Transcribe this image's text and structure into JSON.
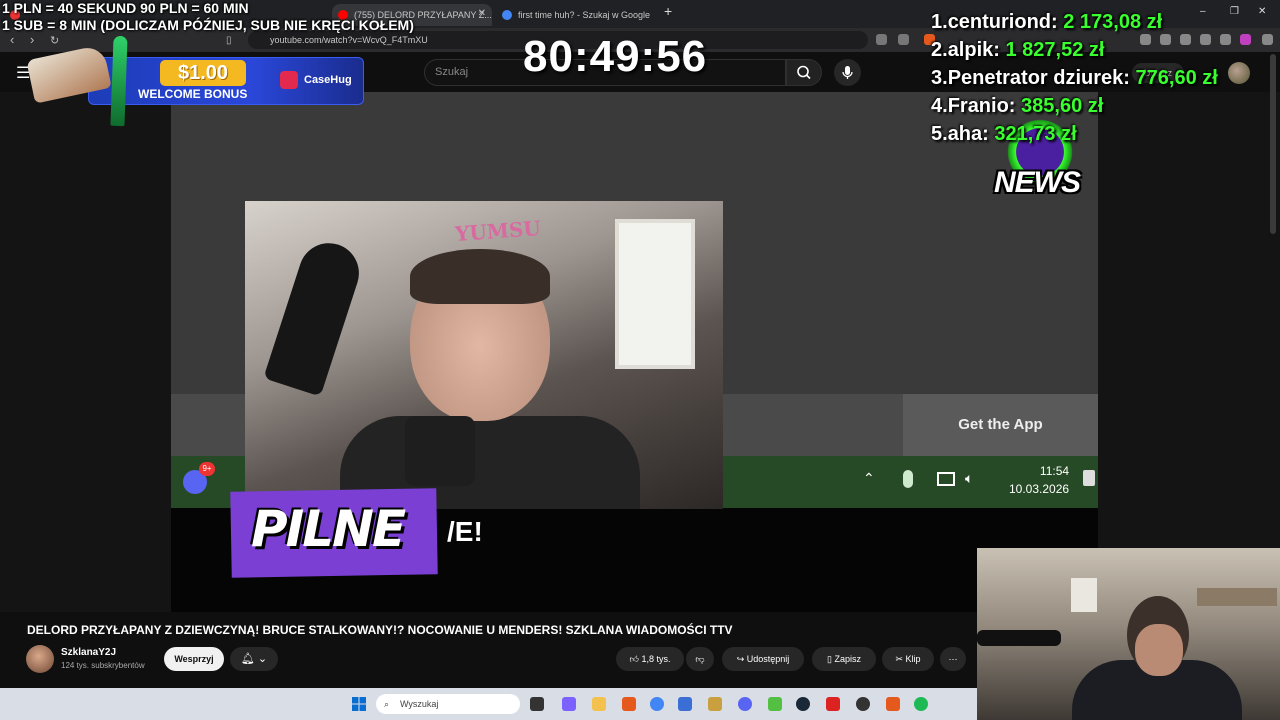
{
  "browser": {
    "tabs": [
      {
        "label": "(755) DELORD PRZYŁAPANY Z...",
        "active": true
      },
      {
        "label": "first time huh? - Szukaj w Google",
        "active": false
      }
    ],
    "url": "youtube.com/watch?v=WcvQ_F4TmXU"
  },
  "youtube": {
    "search_placeholder": "Szukaj",
    "create_label": "Utwórz",
    "video": {
      "getapp_label": "Get the App",
      "taskbar_time": "11:54",
      "taskbar_date": "10.03.2026",
      "discord_badge": "9+",
      "banner_word": "PILNE",
      "banner_suffix": "/E!",
      "webcam_sign": "YUMSU"
    },
    "title": "DELORD PRZYŁAPANY Z DZIEWCZYNĄ! BRUCE STALKOWANY!? NOCOWANIE U MENDERS! SZKLANA WIADOMOŚCI TTV",
    "channel": {
      "name": "SzklanaY2J",
      "subscribers": "124 tys. subskrybentów"
    },
    "support_label": "Wesprzyj",
    "actions": {
      "likes": "1,8 tys.",
      "share": "Udostępnij",
      "save": "Zapisz",
      "clip": "Klip"
    }
  },
  "overlay": {
    "rules_line1": "1 PLN = 40 SEKUND 90 PLN = 60 MIN",
    "rules_line2": "1 SUB = 8 MIN (DOLICZAM PÓŹNIEJ, SUB NIE KRĘCI KOŁEM)",
    "timer": "80:49:56",
    "leaderboard": [
      {
        "rank": "1.",
        "name": "centuriond:",
        "amount": "2 173,08 zł"
      },
      {
        "rank": "2.",
        "name": "alpik:",
        "amount": "1 827,52 zł"
      },
      {
        "rank": "3.",
        "name": "Penetrator dziurek:",
        "amount": "776,60 zł"
      },
      {
        "rank": "4.",
        "name": "Franio:",
        "amount": "385,60 zł"
      },
      {
        "rank": "5.",
        "name": "aha:",
        "amount": "321,73 zł"
      }
    ],
    "promo": {
      "amount": "$1.00",
      "text": "WELCOME BONUS",
      "brand": "CaseHug"
    },
    "news_label": "NEWS"
  },
  "windows": {
    "search_placeholder": "Wyszukaj"
  },
  "colors": {
    "youtube_bg": "#0f0f0f",
    "leaderboard_amount": "#39ff2e",
    "banner_purple": "#7b3fd4",
    "taskbar_green": "#264a26"
  }
}
